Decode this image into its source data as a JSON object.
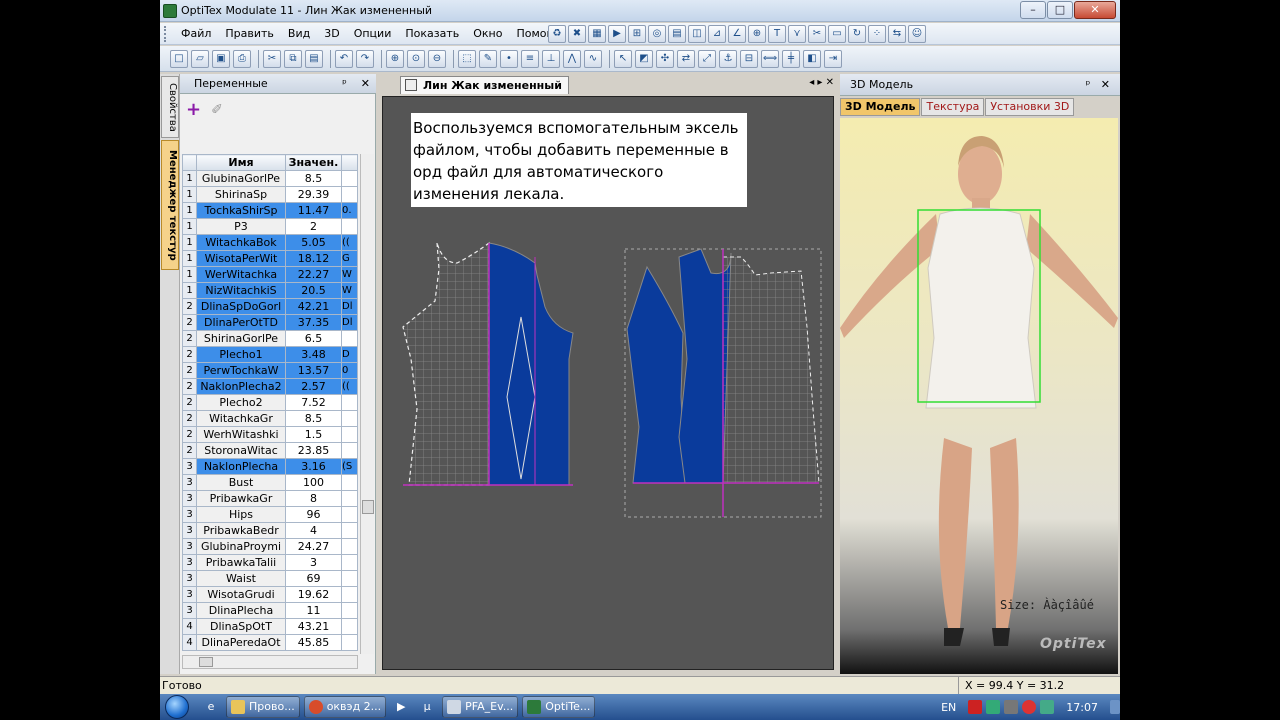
{
  "window": {
    "title": "OptiTex Modulate 11 - Лин Жак измененный",
    "min": "–",
    "max": "□",
    "close": "✕"
  },
  "menu": [
    "Файл",
    "Править",
    "Вид",
    "3D",
    "Опции",
    "Показать",
    "Окно",
    "Помощь"
  ],
  "left_panel": {
    "title": "Переменные",
    "pin": "ᵖ",
    "close": "✕",
    "side_tabs": [
      "Свойства",
      "Менеджер текстур"
    ],
    "table": {
      "headers": [
        "Имя",
        "Значен."
      ],
      "rows": [
        {
          "n": "1",
          "name": "GlubinaGorlPe",
          "value": "8.5",
          "extra": "",
          "sel": false
        },
        {
          "n": "1",
          "name": "ShirinaSp",
          "value": "29.39",
          "extra": "",
          "sel": false
        },
        {
          "n": "1",
          "name": "TochkaShirSp",
          "value": "11.47",
          "extra": "0.",
          "sel": true
        },
        {
          "n": "1",
          "name": "P3",
          "value": "2",
          "extra": "",
          "sel": false
        },
        {
          "n": "1",
          "name": "WitachkaBok",
          "value": "5.05",
          "extra": "((",
          "sel": true
        },
        {
          "n": "1",
          "name": "WisotaPerWit",
          "value": "18.12",
          "extra": "G",
          "sel": true
        },
        {
          "n": "1",
          "name": "WerWitachka",
          "value": "22.27",
          "extra": "W",
          "sel": true
        },
        {
          "n": "1",
          "name": "NizWitachkiS",
          "value": "20.5",
          "extra": "W",
          "sel": true
        },
        {
          "n": "2",
          "name": "DlinaSpDoGorl",
          "value": "42.21",
          "extra": "Dl",
          "sel": true
        },
        {
          "n": "2",
          "name": "DlinaPerOtTD",
          "value": "37.35",
          "extra": "Dl",
          "sel": true
        },
        {
          "n": "2",
          "name": "ShirinaGorlPe",
          "value": "6.5",
          "extra": "",
          "sel": false
        },
        {
          "n": "2",
          "name": "Plecho1",
          "value": "3.48",
          "extra": "D",
          "sel": true
        },
        {
          "n": "2",
          "name": "PerwTochkaW",
          "value": "13.57",
          "extra": "0",
          "sel": true
        },
        {
          "n": "2",
          "name": "NaklonPlecha2",
          "value": "2.57",
          "extra": "((",
          "sel": true
        },
        {
          "n": "2",
          "name": "Plecho2",
          "value": "7.52",
          "extra": "",
          "sel": false
        },
        {
          "n": "2",
          "name": "WitachkaGr",
          "value": "8.5",
          "extra": "",
          "sel": false
        },
        {
          "n": "2",
          "name": "WerhWitashki",
          "value": "1.5",
          "extra": "",
          "sel": false
        },
        {
          "n": "2",
          "name": "StoronaWitac",
          "value": "23.85",
          "extra": "",
          "sel": false
        },
        {
          "n": "3",
          "name": "NaklonPlecha",
          "value": "3.16",
          "extra": "(S",
          "sel": true
        },
        {
          "n": "3",
          "name": "Bust",
          "value": "100",
          "extra": "",
          "sel": false
        },
        {
          "n": "3",
          "name": "PribawkaGr",
          "value": "8",
          "extra": "",
          "sel": false
        },
        {
          "n": "3",
          "name": "Hips",
          "value": "96",
          "extra": "",
          "sel": false
        },
        {
          "n": "3",
          "name": "PribawkaBedr",
          "value": "4",
          "extra": "",
          "sel": false
        },
        {
          "n": "3",
          "name": "GlubinaProymi",
          "value": "24.27",
          "extra": "",
          "sel": false
        },
        {
          "n": "3",
          "name": "PribawkaTalii",
          "value": "3",
          "extra": "",
          "sel": false
        },
        {
          "n": "3",
          "name": "Waist",
          "value": "69",
          "extra": "",
          "sel": false
        },
        {
          "n": "3",
          "name": "WisotaGrudi",
          "value": "19.62",
          "extra": "",
          "sel": false
        },
        {
          "n": "3",
          "name": "DlinaPlecha",
          "value": "11",
          "extra": "",
          "sel": false
        },
        {
          "n": "4",
          "name": "DlinaSpOtT",
          "value": "43.21",
          "extra": "",
          "sel": false
        },
        {
          "n": "4",
          "name": "DlinaPeredaOt",
          "value": "45.85",
          "extra": "",
          "sel": false
        }
      ]
    }
  },
  "workspace": {
    "tab": "Лин Жак измененный",
    "instruction": "Воспользуемся вспомогательным эксель файлом, чтобы добавить переменные в орд файл для автоматического изменения лекала."
  },
  "panel3d": {
    "title": "3D Модель",
    "tabs": [
      "3D Модель",
      "Текстура",
      "Установки 3D"
    ],
    "size_label": "Size: Ààçîâûé",
    "logo": "OptiTex"
  },
  "status": {
    "ready": "Готово",
    "coords": "X = 99.4  Y = 31.2"
  },
  "taskbar": {
    "tasks": [
      "Прово...",
      "оквэд 2...",
      "PFA_Ev...",
      "OptiTe..."
    ],
    "lang": "EN",
    "time": "17:07"
  },
  "colors": {
    "piece_fill": "#0a3b9c",
    "grid_line": "#8a8a8a",
    "point": "#f0e000",
    "selection": "#3d8ee9"
  }
}
